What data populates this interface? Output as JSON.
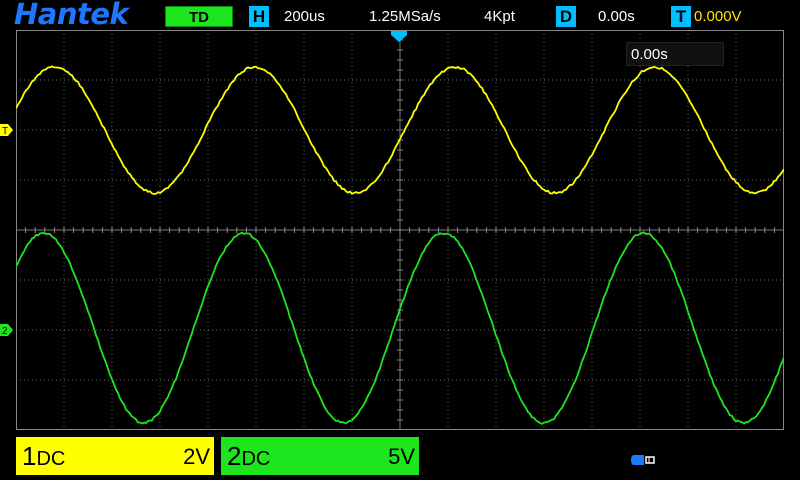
{
  "header": {
    "brand": "Hantek",
    "mode": "TD",
    "h_tag": "H",
    "timebase": "200us",
    "sample_rate": "1.25MSa/s",
    "mem_depth": "4Kpt",
    "d_tag": "D",
    "delay": "0.00s",
    "t_tag": "T",
    "trigger_level": "0.000V"
  },
  "cursor_readout": "0.00s",
  "channels": [
    {
      "id": "1",
      "coupling": "DC",
      "scale": "2V",
      "color": "#ffff00",
      "marker": "T"
    },
    {
      "id": "2",
      "coupling": "DC",
      "scale": "5V",
      "color": "#1ee61e",
      "marker": "2"
    }
  ],
  "colors": {
    "brand": "#1e78ff",
    "accent": "#00bfff",
    "ch1": "#ffff00",
    "ch2": "#1ee61e",
    "grid": "#888888"
  },
  "icons": {
    "usb": "usb-icon"
  }
}
